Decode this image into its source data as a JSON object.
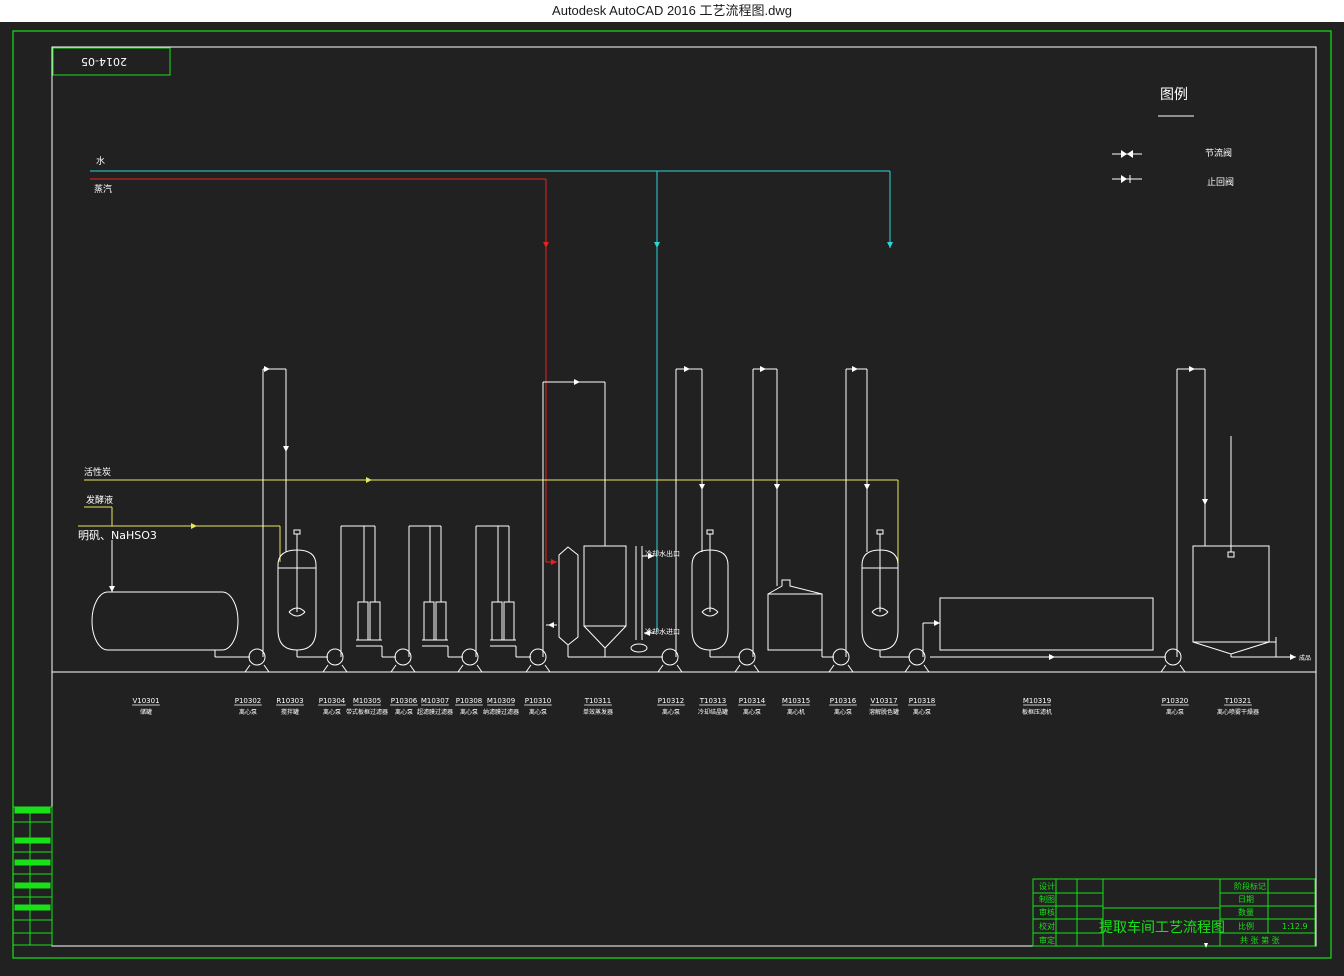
{
  "window": {
    "title": "Autodesk AutoCAD 2016     工艺流程图.dwg"
  },
  "drawing": {
    "stamp": "2014-05",
    "legend": {
      "title": "图例",
      "items": [
        {
          "label": "节流阀"
        },
        {
          "label": "止回阀"
        }
      ]
    },
    "utilities": [
      {
        "label": "水"
      },
      {
        "label": "蒸汽"
      }
    ],
    "feeds": [
      {
        "label": "活性炭"
      },
      {
        "label": "发酵液"
      },
      {
        "label": "明矾、NaHSO3"
      }
    ],
    "equipment": [
      {
        "code": "V10301",
        "desc": "储罐"
      },
      {
        "code": "P10302",
        "desc": "离心泵"
      },
      {
        "code": "R10303",
        "desc": "搅拌罐"
      },
      {
        "code": "P10304",
        "desc": "离心泵"
      },
      {
        "code": "M10305",
        "desc": "带式板框过滤器"
      },
      {
        "code": "P10306",
        "desc": "离心泵"
      },
      {
        "code": "M10307",
        "desc": "超滤膜过滤器"
      },
      {
        "code": "P10308",
        "desc": "离心泵"
      },
      {
        "code": "M10309",
        "desc": "纳滤膜过滤器"
      },
      {
        "code": "P10310",
        "desc": "离心泵"
      },
      {
        "code": "T10311",
        "desc": "单效蒸发器"
      },
      {
        "code": "P10312",
        "desc": "离心泵"
      },
      {
        "code": "T10313",
        "desc": "冷却结晶罐"
      },
      {
        "code": "P10314",
        "desc": "离心泵"
      },
      {
        "code": "M10315",
        "desc": "离心机"
      },
      {
        "code": "P10316",
        "desc": "离心泵"
      },
      {
        "code": "V10317",
        "desc": "溶解脱色罐"
      },
      {
        "code": "P10318",
        "desc": "离心泵"
      },
      {
        "code": "M10319",
        "desc": "板框压滤机"
      },
      {
        "code": "P10320",
        "desc": "离心泵"
      },
      {
        "code": "T10321",
        "desc": "离心喷雾干燥器"
      }
    ],
    "annotations": {
      "cooling_out": "冷却水出口",
      "cooling_in": "冷却水进口",
      "product": "成品"
    },
    "title_block": {
      "drawing_title": "提取车间工艺流程图",
      "left_labels": [
        "设计",
        "制图",
        "审核",
        "校对",
        "审定"
      ],
      "right_labels": [
        "阶段标记",
        "日期",
        "数量",
        "比例"
      ],
      "scale_value": "1:12.9",
      "sheet_info": "共 张 第 张"
    },
    "colors": {
      "background": "#212121",
      "border": "#17e117",
      "linework": "#ffffff",
      "water": "#2ad6d6",
      "steam": "#e62121",
      "feed": "#e6e65a"
    }
  }
}
